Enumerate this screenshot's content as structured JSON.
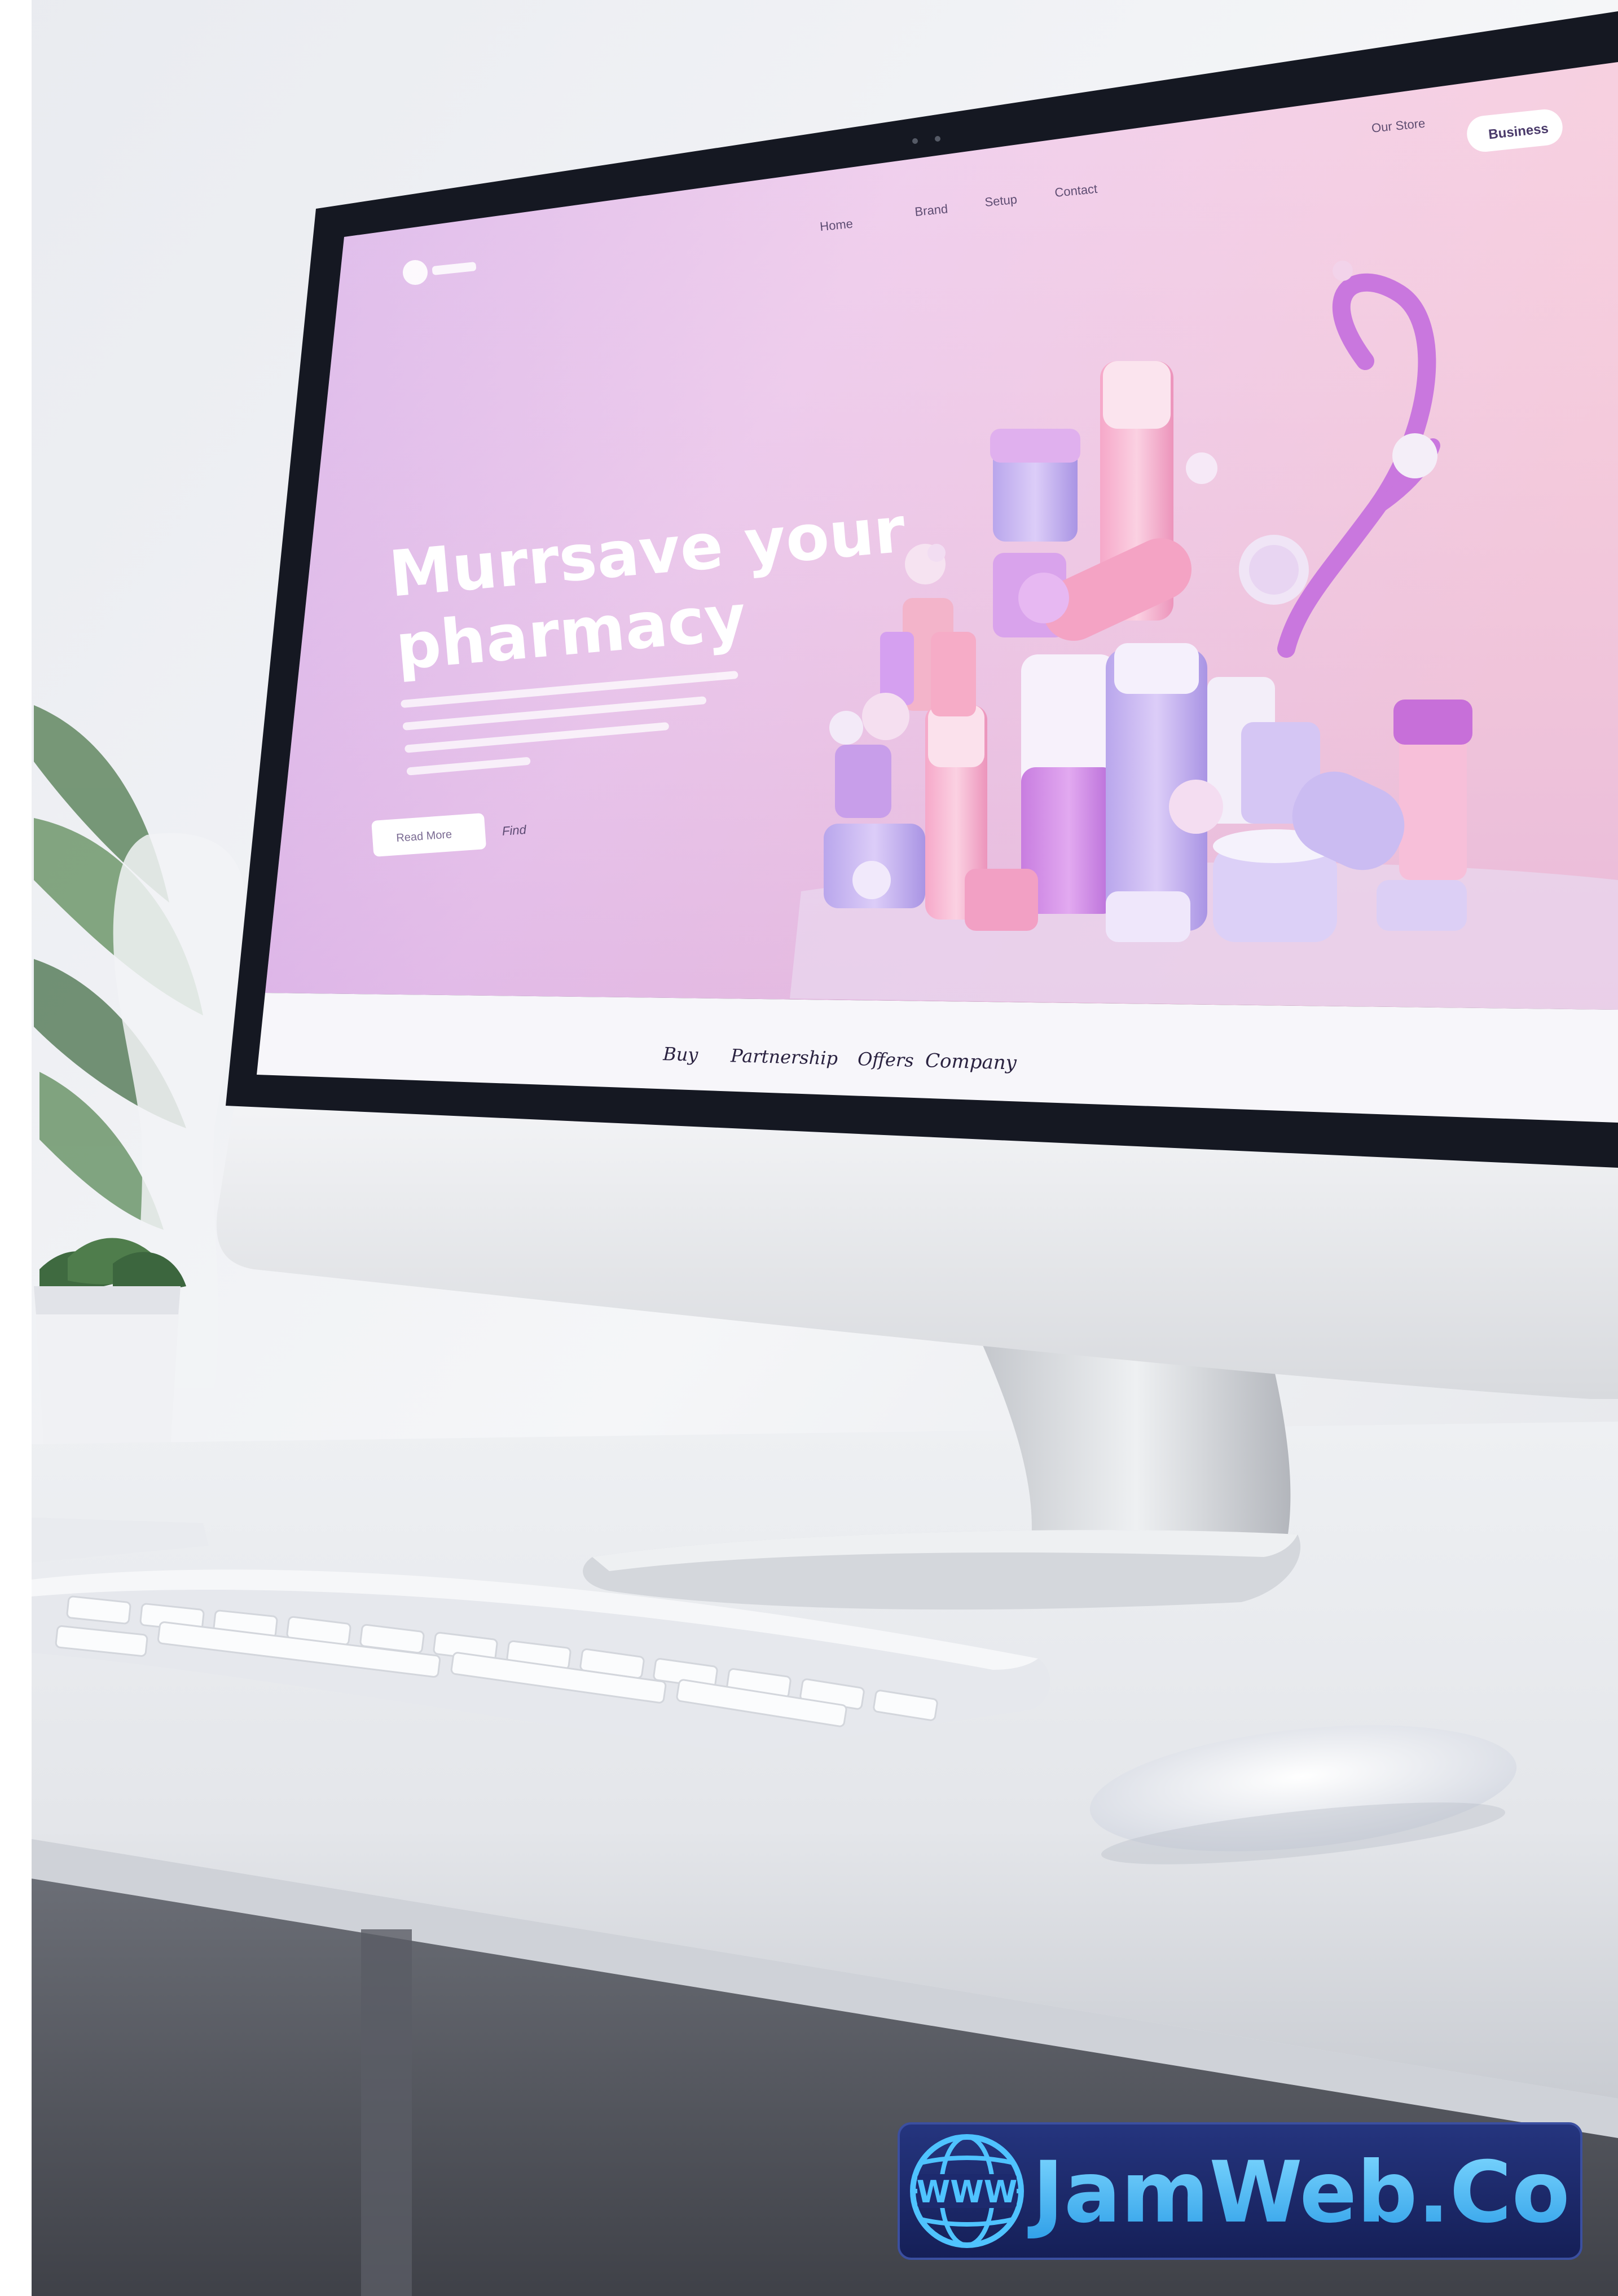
{
  "screen": {
    "header": {
      "nav_links": [
        "Home",
        "Brand",
        "Setup",
        "Contact"
      ],
      "login_text": "Our Store",
      "cta_button": "Business"
    },
    "hero": {
      "title_line1": "Murrsave your",
      "title_line2": "pharmacy",
      "primary_button": "Read More",
      "secondary_link": "Find"
    },
    "bottom_nav": [
      "Buy",
      "Partnership",
      "Offers",
      "Company"
    ]
  },
  "watermark": {
    "brand": "JamWeb.Co",
    "globe_label": "WWW"
  },
  "colors": {
    "hero_pink": "#f3c6e3",
    "hero_lavender": "#d5b3ee",
    "watermark_bg": "#1d2a6e",
    "watermark_text": "#4fc3ff"
  }
}
